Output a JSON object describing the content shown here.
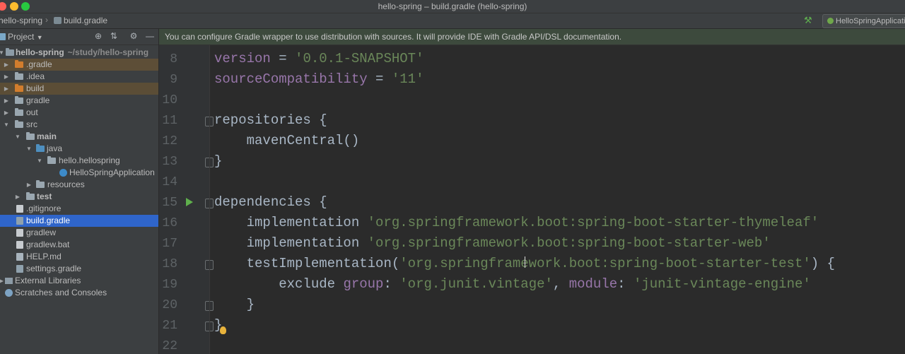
{
  "window": {
    "title": "hello-spring – build.gradle (hello-spring)"
  },
  "navbar": {
    "project_crumb": "hello-spring",
    "file_crumb": "build.gradle",
    "run_config": "HelloSpringApplication"
  },
  "project_panel": {
    "title": "Project",
    "tree": [
      {
        "label": "hello-spring",
        "path": "~/study/hello-spring"
      },
      {
        "label": ".gradle"
      },
      {
        "label": ".idea"
      },
      {
        "label": "build"
      },
      {
        "label": "gradle"
      },
      {
        "label": "out"
      },
      {
        "label": "src"
      },
      {
        "label": "main"
      },
      {
        "label": "java"
      },
      {
        "label": "hello.hellospring"
      },
      {
        "label": "HelloSpringApplication"
      },
      {
        "label": "resources"
      },
      {
        "label": "test"
      },
      {
        "label": ".gitignore"
      },
      {
        "label": "build.gradle"
      },
      {
        "label": "gradlew"
      },
      {
        "label": "gradlew.bat"
      },
      {
        "label": "HELP.md"
      },
      {
        "label": "settings.gradle"
      },
      {
        "label": "External Libraries"
      },
      {
        "label": "Scratches and Consoles"
      }
    ]
  },
  "editor": {
    "banner": "You can configure Gradle wrapper to use distribution with sources. It will provide IDE with Gradle API/DSL documentation.",
    "line_numbers": [
      "8",
      "9",
      "10",
      "11",
      "12",
      "13",
      "14",
      "15",
      "16",
      "17",
      "18",
      "19",
      "20",
      "21",
      "22"
    ],
    "lines": {
      "l8_key": "version",
      "l8_op": " = ",
      "l8_str": "'0.0.1-SNAPSHOT'",
      "l9_key": "sourceCompatibility",
      "l9_op": " = ",
      "l9_str": "'11'",
      "l11": "repositories {",
      "l12": "    mavenCentral()",
      "l13": "}",
      "l15": "dependencies {",
      "l16_fn": "    implementation ",
      "l16_str": "'org.springframework.boot:spring-boot-starter-thymeleaf'",
      "l17_fn": "    implementation ",
      "l17_str": "'org.springframework.boot:spring-boot-starter-web'",
      "l18_fn": "    testImplementation(",
      "l18_str": "'org.springframework.boot:spring-boot-starter-test'",
      "l18_end": ") {",
      "l19_fn": "        exclude ",
      "l19_grp": "group",
      "l19_sep1": ": ",
      "l19_str1": "'org.junit.vintage'",
      "l19_sep2": ", ",
      "l19_mod": "module",
      "l19_sep3": ": ",
      "l19_str2": "'junit-vintage-engine'",
      "l20": "    }",
      "l21": "}"
    }
  },
  "colors": {
    "editor_bg": "#2b2b2b",
    "string": "#6a8759",
    "property": "#9876aa",
    "selection": "#2f65ca"
  }
}
